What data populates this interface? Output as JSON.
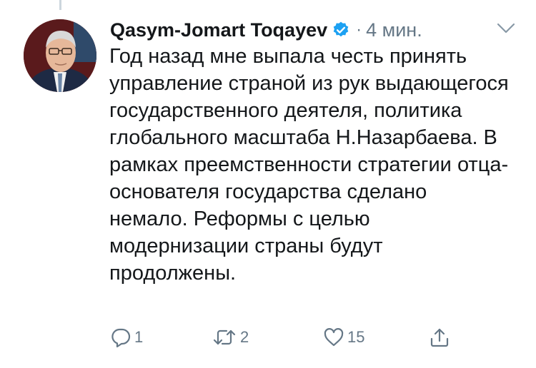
{
  "tweet": {
    "author_name": "Qasym-Jomart Toqayev",
    "separator": "·",
    "timestamp": "4 мин.",
    "text": "Год назад мне выпала честь принять управление страной из рук выдающегося государственного деятеля, политика глобального масштаба Н.Назарбаева. В рамках преемственности стратегии отца-основателя государства сделано немало. Реформы с целью модернизации страны будут продолжены."
  },
  "actions": {
    "reply_count": "1",
    "retweet_count": "2",
    "like_count": "15"
  },
  "icons": {
    "verified": "verified-badge-icon",
    "menu": "chevron-down-icon",
    "reply": "reply-icon",
    "retweet": "retweet-icon",
    "like": "heart-icon",
    "share": "share-icon"
  },
  "colors": {
    "text": "#14171a",
    "secondary": "#657786",
    "verified": "#1da1f2",
    "thread_line": "#ccd6dd"
  }
}
